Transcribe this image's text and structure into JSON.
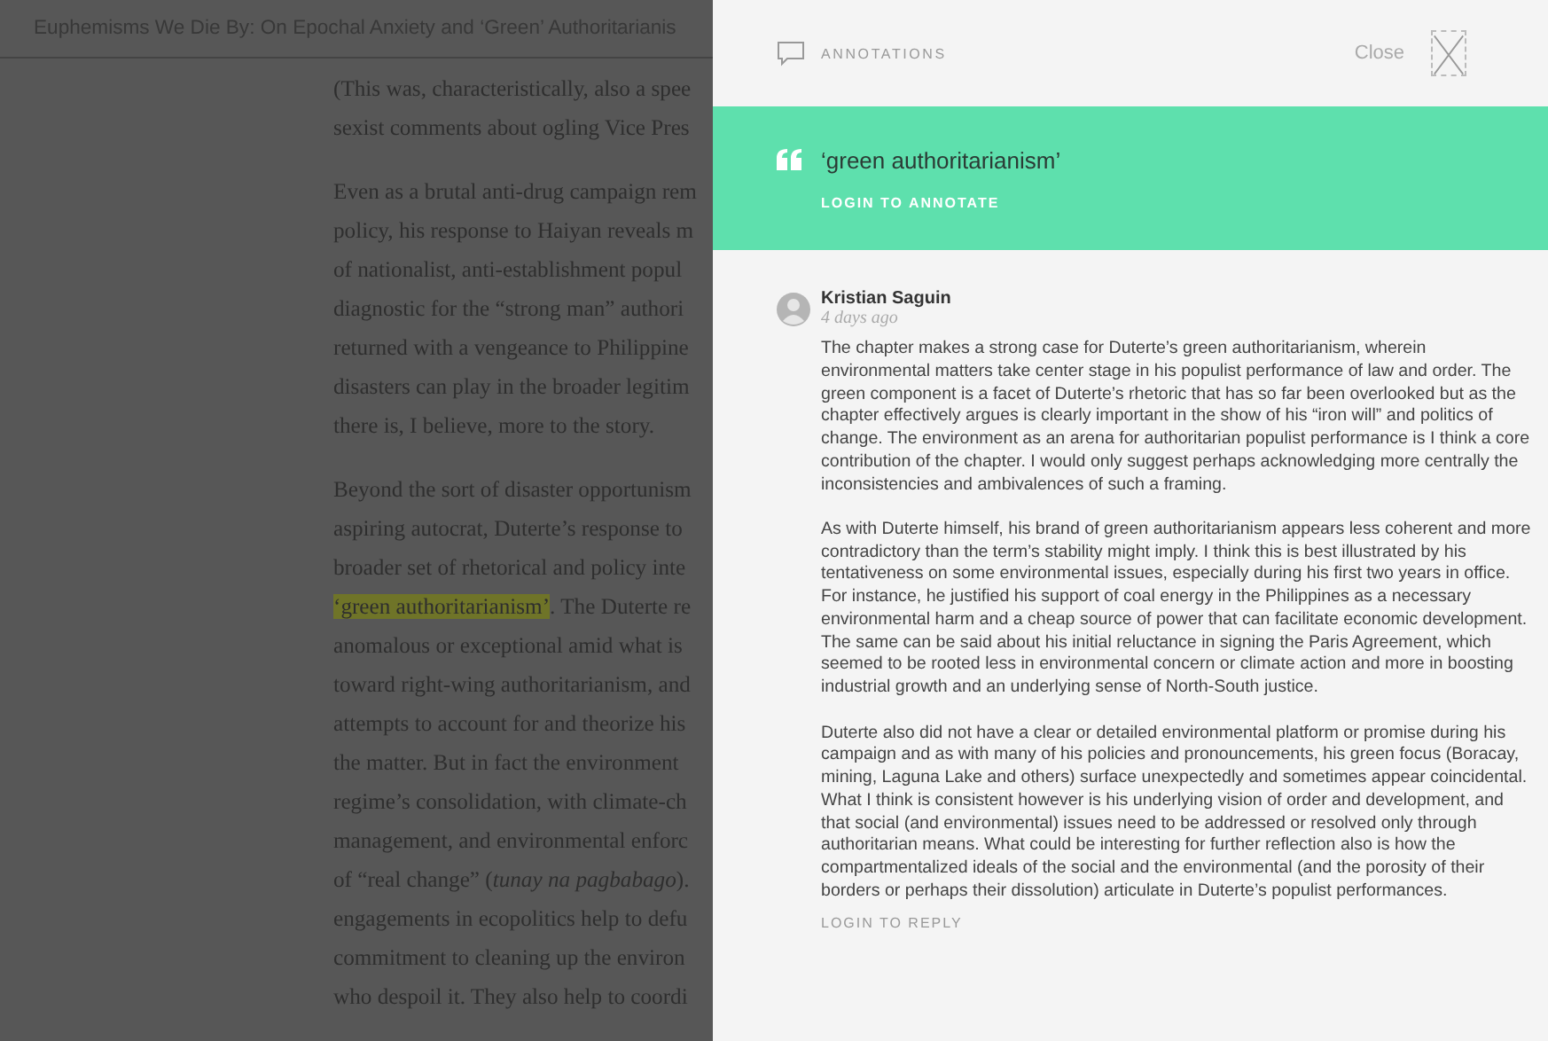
{
  "article": {
    "title": "Euphemisms We Die By: On Epochal Anxiety and ‘Green’ Authoritarianis",
    "paragraphs": [
      [
        {
          "text": "(This was, characteristically, also a spee"
        },
        {
          "text": "sexist comments about ogling Vice Pres"
        }
      ],
      [
        {
          "text": "Even as a brutal anti-drug campaign rem"
        },
        {
          "text": "policy, his response to Haiyan reveals m"
        },
        {
          "text": "of nationalist, anti-establishment popul"
        },
        {
          "text": "diagnostic for the “strong man” authori"
        },
        {
          "text": "returned with a vengeance to Philippine"
        },
        {
          "text": "disasters can play in the broader legitim"
        },
        {
          "text": "there is, I believe, more to the story."
        }
      ],
      [
        {
          "text": "Beyond the sort of disaster opportunism"
        },
        {
          "text": "aspiring autocrat, Duterte’s response to"
        },
        {
          "text": "broader set of rhetorical and policy inte"
        },
        {
          "highlighted_text": "‘green authoritarianism’",
          "text": ". The Duterte re"
        },
        {
          "text": "anomalous or exceptional amid what is"
        },
        {
          "text": "toward right-wing authoritarianism, and"
        },
        {
          "text": "attempts to account for and theorize his"
        },
        {
          "text": "the matter. But in fact the environment"
        },
        {
          "text": "regime’s consolidation, with climate-ch"
        },
        {
          "text": "management, and environmental enforc"
        },
        {
          "text": "of “real change” (*tunay na pagbabago*)."
        },
        {
          "text": "engagements in ecopolitics help to defu"
        },
        {
          "text": "commitment to cleaning up the environ"
        },
        {
          "text": "who despoil it. They also help to coordi"
        }
      ]
    ]
  },
  "panel": {
    "heading": "ANNOTATIONS",
    "close_label": "Close",
    "quote": {
      "text": "‘green authoritarianism’",
      "login": "LOGIN TO ANNOTATE"
    },
    "comments": [
      {
        "author": "Kristian Saguin",
        "time": "4 days ago",
        "paragraphs": [
          "The chapter makes a strong case for Duterte’s green authoritarianism, wherein environmental matters take center stage in his populist performance of law and order. The green component is a facet of Duterte’s rhetoric that has so far been overlooked but as the chapter effectively argues is clearly important in the show of his “iron will” and politics of change. The environment as an arena for authoritarian populist performance is I think a core contribution of the chapter. I would only suggest perhaps acknowledging more centrally the inconsistencies and ambivalences of such a framing.",
          "As with Duterte himself, his brand of green authoritarianism appears less coherent and more contradictory than the term’s stability might imply. I think this is best illustrated by his tentativeness on some environmental issues, especially during his first two years in office. For instance, he justified his support of coal energy in the Philippines as a necessary environmental harm and a cheap source of power that can facilitate economic development. The same can be said about his initial reluctance in signing the Paris Agreement, which seemed to be rooted less in environmental concern or climate action and more in boosting industrial growth and an underlying sense of North-South justice.",
          "Duterte also did not have a clear or detailed environmental platform or promise during his campaign and as with many of his policies and pronouncements, his green focus (Boracay, mining, Laguna Lake and others) surface unexpectedly and sometimes appear coincidental. What I think is consistent however is his underlying vision of order and development, and that social (and environmental) issues need to be addressed or resolved only through authoritarian means. What could be interesting for further reflection also is how the compartmentalized ideals of the social and the environmental (and the porosity of their borders or perhaps their dissolution) articulate in Duterte’s populist performances."
        ],
        "reply": "LOGIN TO REPLY"
      }
    ]
  }
}
